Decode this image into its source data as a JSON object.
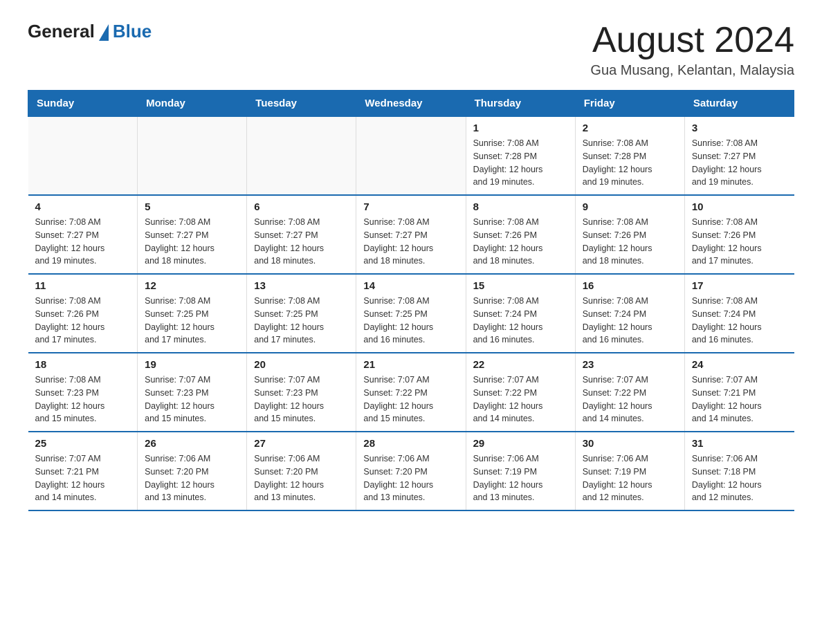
{
  "logo": {
    "text_general": "General",
    "text_blue": "Blue"
  },
  "title": "August 2024",
  "subtitle": "Gua Musang, Kelantan, Malaysia",
  "days_header": [
    "Sunday",
    "Monday",
    "Tuesday",
    "Wednesday",
    "Thursday",
    "Friday",
    "Saturday"
  ],
  "weeks": [
    [
      {
        "num": "",
        "info": ""
      },
      {
        "num": "",
        "info": ""
      },
      {
        "num": "",
        "info": ""
      },
      {
        "num": "",
        "info": ""
      },
      {
        "num": "1",
        "info": "Sunrise: 7:08 AM\nSunset: 7:28 PM\nDaylight: 12 hours\nand 19 minutes."
      },
      {
        "num": "2",
        "info": "Sunrise: 7:08 AM\nSunset: 7:28 PM\nDaylight: 12 hours\nand 19 minutes."
      },
      {
        "num": "3",
        "info": "Sunrise: 7:08 AM\nSunset: 7:27 PM\nDaylight: 12 hours\nand 19 minutes."
      }
    ],
    [
      {
        "num": "4",
        "info": "Sunrise: 7:08 AM\nSunset: 7:27 PM\nDaylight: 12 hours\nand 19 minutes."
      },
      {
        "num": "5",
        "info": "Sunrise: 7:08 AM\nSunset: 7:27 PM\nDaylight: 12 hours\nand 18 minutes."
      },
      {
        "num": "6",
        "info": "Sunrise: 7:08 AM\nSunset: 7:27 PM\nDaylight: 12 hours\nand 18 minutes."
      },
      {
        "num": "7",
        "info": "Sunrise: 7:08 AM\nSunset: 7:27 PM\nDaylight: 12 hours\nand 18 minutes."
      },
      {
        "num": "8",
        "info": "Sunrise: 7:08 AM\nSunset: 7:26 PM\nDaylight: 12 hours\nand 18 minutes."
      },
      {
        "num": "9",
        "info": "Sunrise: 7:08 AM\nSunset: 7:26 PM\nDaylight: 12 hours\nand 18 minutes."
      },
      {
        "num": "10",
        "info": "Sunrise: 7:08 AM\nSunset: 7:26 PM\nDaylight: 12 hours\nand 17 minutes."
      }
    ],
    [
      {
        "num": "11",
        "info": "Sunrise: 7:08 AM\nSunset: 7:26 PM\nDaylight: 12 hours\nand 17 minutes."
      },
      {
        "num": "12",
        "info": "Sunrise: 7:08 AM\nSunset: 7:25 PM\nDaylight: 12 hours\nand 17 minutes."
      },
      {
        "num": "13",
        "info": "Sunrise: 7:08 AM\nSunset: 7:25 PM\nDaylight: 12 hours\nand 17 minutes."
      },
      {
        "num": "14",
        "info": "Sunrise: 7:08 AM\nSunset: 7:25 PM\nDaylight: 12 hours\nand 16 minutes."
      },
      {
        "num": "15",
        "info": "Sunrise: 7:08 AM\nSunset: 7:24 PM\nDaylight: 12 hours\nand 16 minutes."
      },
      {
        "num": "16",
        "info": "Sunrise: 7:08 AM\nSunset: 7:24 PM\nDaylight: 12 hours\nand 16 minutes."
      },
      {
        "num": "17",
        "info": "Sunrise: 7:08 AM\nSunset: 7:24 PM\nDaylight: 12 hours\nand 16 minutes."
      }
    ],
    [
      {
        "num": "18",
        "info": "Sunrise: 7:08 AM\nSunset: 7:23 PM\nDaylight: 12 hours\nand 15 minutes."
      },
      {
        "num": "19",
        "info": "Sunrise: 7:07 AM\nSunset: 7:23 PM\nDaylight: 12 hours\nand 15 minutes."
      },
      {
        "num": "20",
        "info": "Sunrise: 7:07 AM\nSunset: 7:23 PM\nDaylight: 12 hours\nand 15 minutes."
      },
      {
        "num": "21",
        "info": "Sunrise: 7:07 AM\nSunset: 7:22 PM\nDaylight: 12 hours\nand 15 minutes."
      },
      {
        "num": "22",
        "info": "Sunrise: 7:07 AM\nSunset: 7:22 PM\nDaylight: 12 hours\nand 14 minutes."
      },
      {
        "num": "23",
        "info": "Sunrise: 7:07 AM\nSunset: 7:22 PM\nDaylight: 12 hours\nand 14 minutes."
      },
      {
        "num": "24",
        "info": "Sunrise: 7:07 AM\nSunset: 7:21 PM\nDaylight: 12 hours\nand 14 minutes."
      }
    ],
    [
      {
        "num": "25",
        "info": "Sunrise: 7:07 AM\nSunset: 7:21 PM\nDaylight: 12 hours\nand 14 minutes."
      },
      {
        "num": "26",
        "info": "Sunrise: 7:06 AM\nSunset: 7:20 PM\nDaylight: 12 hours\nand 13 minutes."
      },
      {
        "num": "27",
        "info": "Sunrise: 7:06 AM\nSunset: 7:20 PM\nDaylight: 12 hours\nand 13 minutes."
      },
      {
        "num": "28",
        "info": "Sunrise: 7:06 AM\nSunset: 7:20 PM\nDaylight: 12 hours\nand 13 minutes."
      },
      {
        "num": "29",
        "info": "Sunrise: 7:06 AM\nSunset: 7:19 PM\nDaylight: 12 hours\nand 13 minutes."
      },
      {
        "num": "30",
        "info": "Sunrise: 7:06 AM\nSunset: 7:19 PM\nDaylight: 12 hours\nand 12 minutes."
      },
      {
        "num": "31",
        "info": "Sunrise: 7:06 AM\nSunset: 7:18 PM\nDaylight: 12 hours\nand 12 minutes."
      }
    ]
  ]
}
